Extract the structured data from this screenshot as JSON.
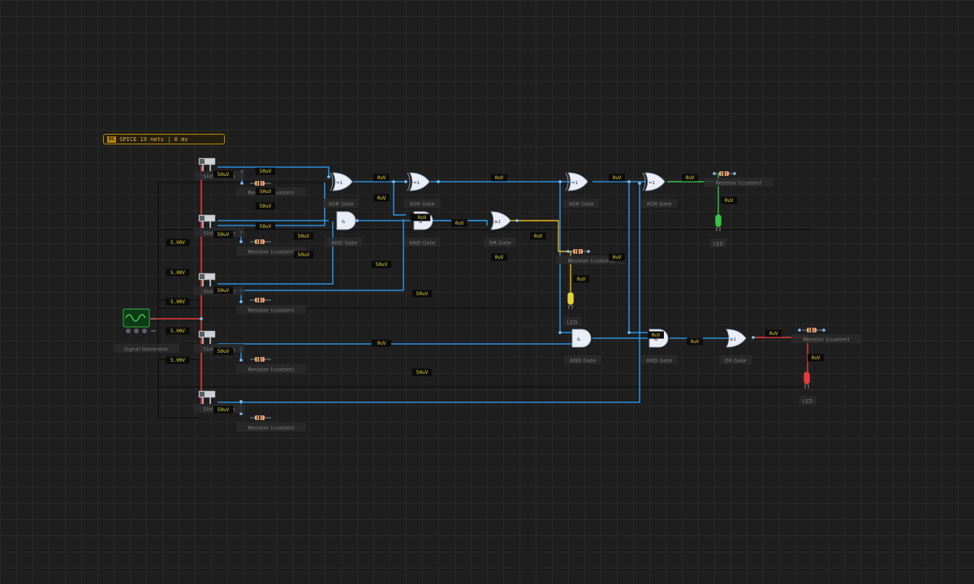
{
  "status": {
    "badge": "DC",
    "text": "SPICE 19 nets | 0 ms"
  },
  "colors": {
    "wire": "#2ea3ff",
    "power": "#e53b3b",
    "ground": "#111111",
    "signal_yellow": "#e7b31d",
    "signal_green": "#39c24a",
    "gate_fill": "#e8edf6",
    "label_bg": "#2a2a2a"
  },
  "components": {
    "signal_generator": "Signal Generator",
    "slide_switches": [
      "Slide Switch",
      "Slide Switch",
      "Slide Switch",
      "Slide Switch",
      "Slide Switch"
    ],
    "resistors": [
      "Resistor (custom)",
      "Resistor (custom)",
      "Resistor (custom)",
      "Resistor (custom)",
      "Resistor (custom)",
      "Resistor (custom)",
      "Resistor (custom)",
      "Resistor (custom)"
    ],
    "gates": [
      {
        "label": "XOR Gate",
        "symbol": "=1"
      },
      {
        "label": "XOR Gate",
        "symbol": "=1"
      },
      {
        "label": "XOR Gate",
        "symbol": "=1"
      },
      {
        "label": "XOR Gate",
        "symbol": "=1"
      },
      {
        "label": "AND Gate",
        "symbol": "&"
      },
      {
        "label": "AND Gate",
        "symbol": "&"
      },
      {
        "label": "OR Gate",
        "symbol": "≥1"
      },
      {
        "label": "AND Gate",
        "symbol": "&"
      },
      {
        "label": "AND Gate",
        "symbol": "&"
      },
      {
        "label": "OR Gate",
        "symbol": "≥1"
      }
    ],
    "leds": [
      "LED",
      "LED",
      "LED"
    ]
  },
  "probes": [
    "50uV",
    "50uV",
    "50uV",
    "50uV",
    "50uV",
    "50uV",
    "50uV",
    "50uV",
    "50uV",
    "50uV",
    "50uV",
    "50uV",
    "50uV",
    "50uV",
    "50uV",
    "50uV",
    "5.00V",
    "5.00V",
    "5.00V",
    "5.00V",
    "5.00V",
    "0uV",
    "0uV",
    "0uV",
    "0uV",
    "0uV",
    "0uV",
    "0uV",
    "0uV",
    "0uV",
    "0uV",
    "0uV",
    "0uV",
    "0uV",
    "0uV",
    "0uV",
    "0uV",
    "0uV",
    "0uV"
  ]
}
